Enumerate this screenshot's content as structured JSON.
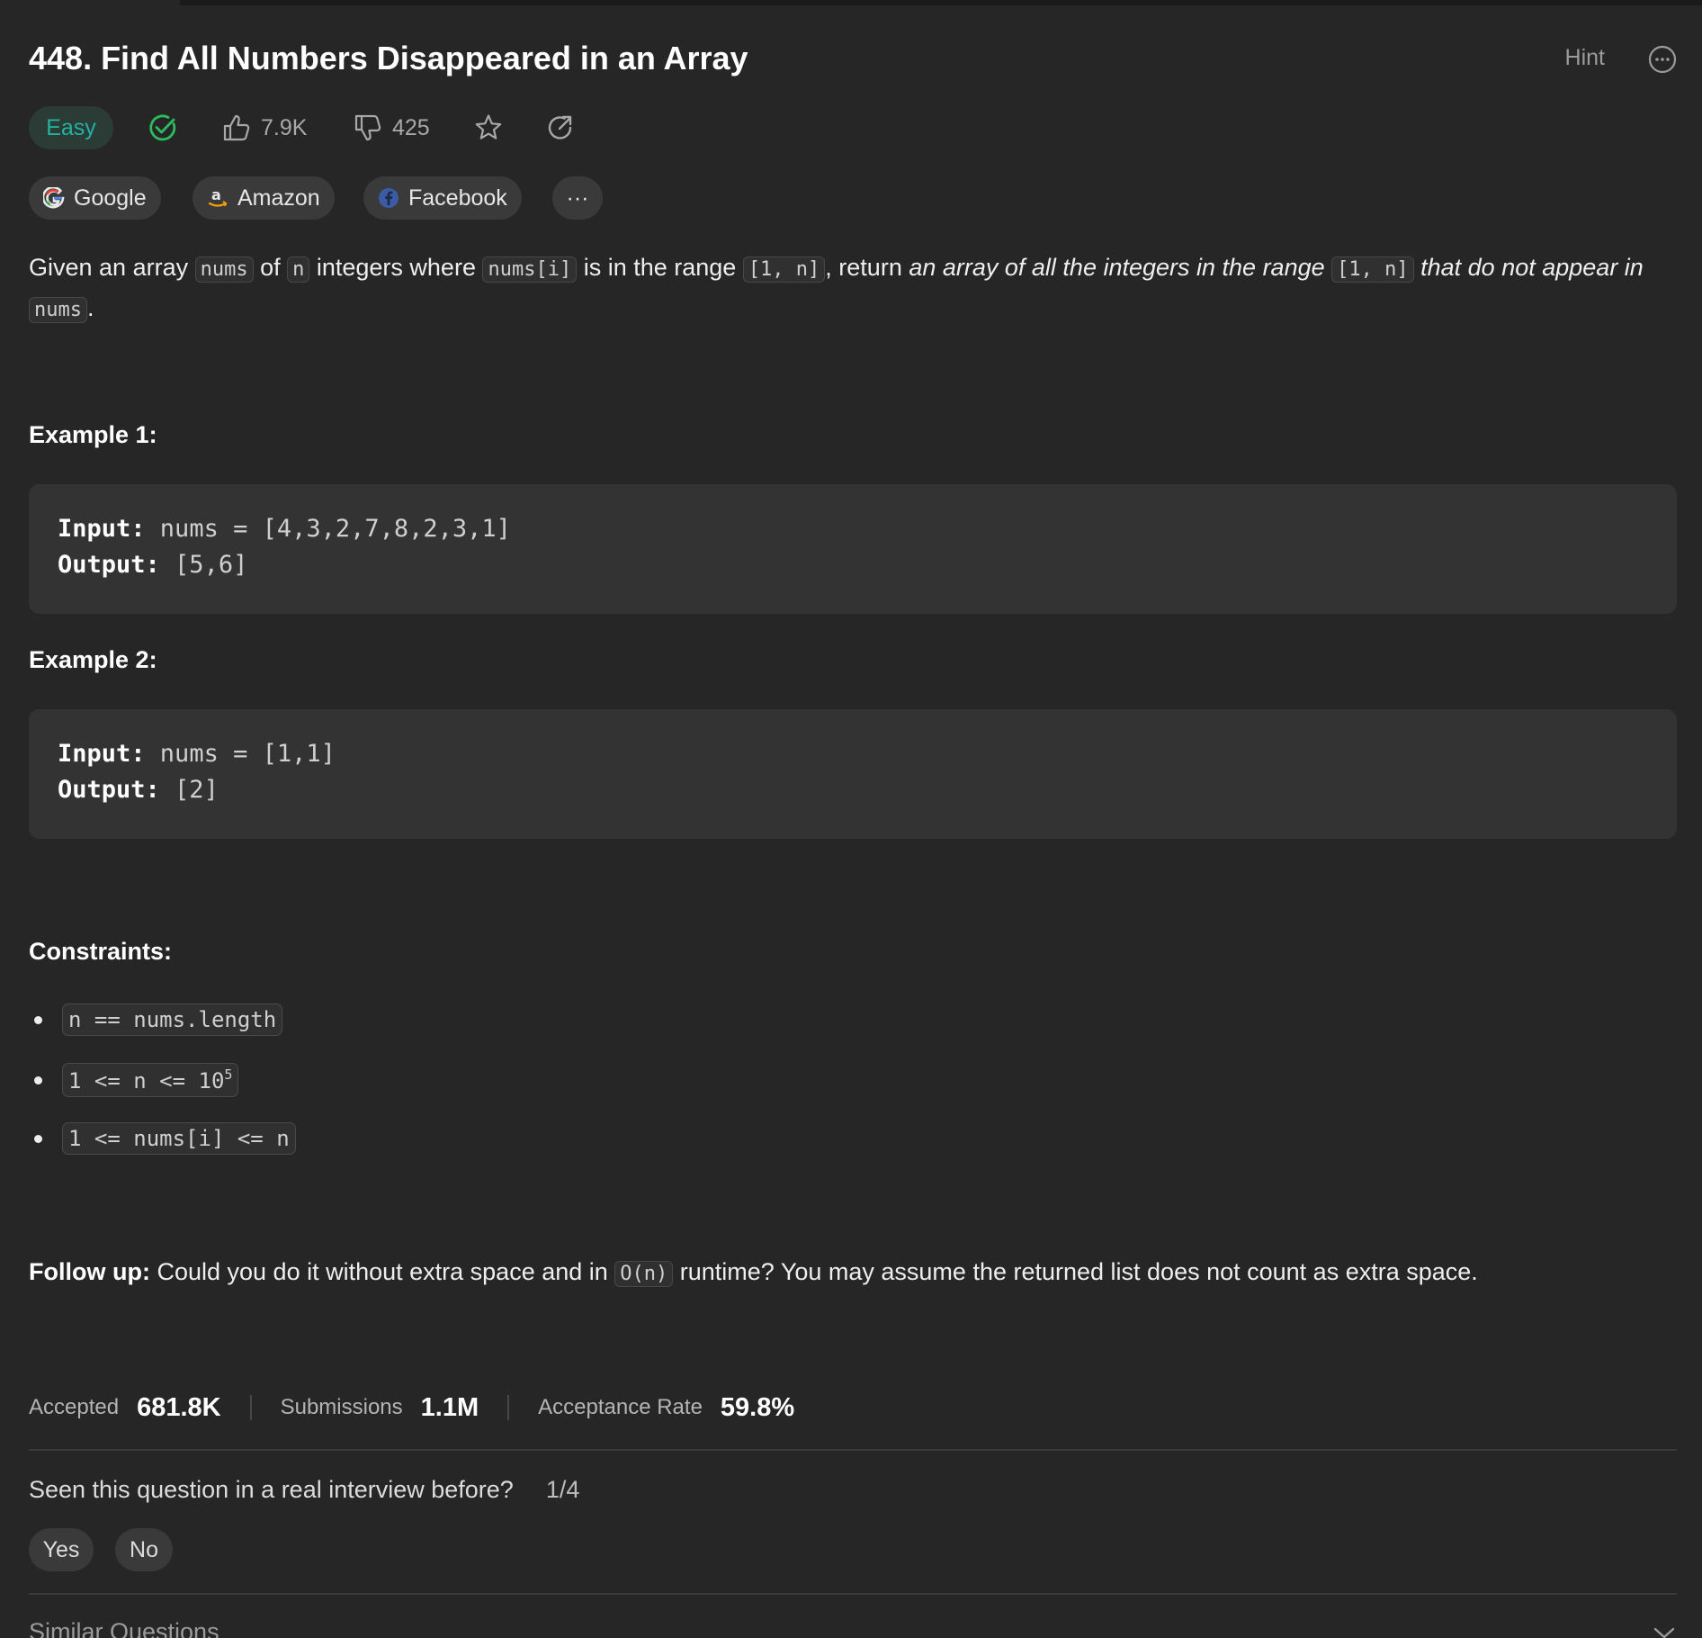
{
  "problem": {
    "title": "448. Find All Numbers Disappeared in an Array",
    "hint_label": "Hint",
    "difficulty": "Easy",
    "likes": "7.9K",
    "dislikes": "425"
  },
  "companies": [
    {
      "name": "Google"
    },
    {
      "name": "Amazon"
    },
    {
      "name": "Facebook"
    }
  ],
  "more_companies_label": "···",
  "description": {
    "t1": "Given an array ",
    "c1": "nums",
    "t2": " of ",
    "c2": "n",
    "t3": " integers where ",
    "c3": "nums[i]",
    "t4": " is in the range ",
    "c4": "[1, n]",
    "t5": ", return ",
    "e1": "an array of all the integers in the range ",
    "c5": "[1, n]",
    "e2": " that do not appear in ",
    "c6": "nums",
    "t6": "."
  },
  "examples": [
    {
      "heading": "Example 1:",
      "input_label": "Input:",
      "input_value": " nums = [4,3,2,7,8,2,3,1]",
      "output_label": "Output:",
      "output_value": " [5,6]"
    },
    {
      "heading": "Example 2:",
      "input_label": "Input:",
      "input_value": " nums = [1,1]",
      "output_label": "Output:",
      "output_value": " [2]"
    }
  ],
  "constraints": {
    "heading": "Constraints:",
    "items": [
      "n == nums.length",
      "1 <= n <= 10",
      "1 <= nums[i] <= n"
    ],
    "sup": "5"
  },
  "followup": {
    "label": "Follow up:",
    "t1": " Could you do it without extra space and in ",
    "code": "O(n)",
    "t2": " runtime? You may assume the returned list does not count as extra space."
  },
  "stats": {
    "accepted_label": "Accepted",
    "accepted_value": "681.8K",
    "submissions_label": "Submissions",
    "submissions_value": "1.1M",
    "rate_label": "Acceptance Rate",
    "rate_value": "59.8%"
  },
  "interview": {
    "question": "Seen this question in a real interview before?",
    "count": "1/4",
    "yes": "Yes",
    "no": "No"
  },
  "similar_label": "Similar Questions",
  "colors": {
    "easy": "#23b2a2",
    "solved": "#2cbb5d",
    "background": "#262626"
  }
}
